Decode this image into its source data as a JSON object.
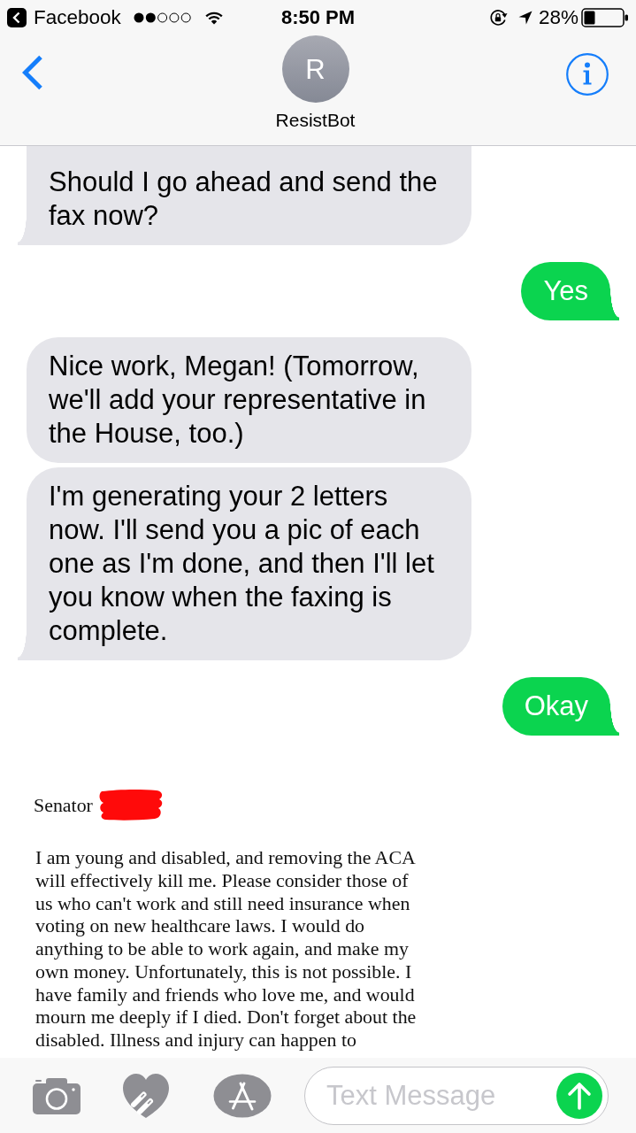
{
  "status_bar": {
    "back_app": "Facebook",
    "time": "8:50 PM",
    "battery": "28%"
  },
  "header": {
    "avatar_initial": "R",
    "contact_name": "ResistBot"
  },
  "messages": [
    {
      "kind": "text",
      "outgoing": false,
      "tail": true,
      "text": "Should I go ahead and send the fax now?"
    },
    {
      "kind": "text",
      "outgoing": true,
      "tail": true,
      "text": "Yes"
    },
    {
      "kind": "text",
      "outgoing": false,
      "tail": false,
      "text": "Nice work, Megan! (Tomorrow, we'll add your representative in the House, too.)"
    },
    {
      "kind": "text",
      "outgoing": false,
      "tail": true,
      "text": "I'm generating your 2 letters now. I'll send you a pic of each one as I'm done, and then I'll let you know when the faxing is complete."
    },
    {
      "kind": "text",
      "outgoing": true,
      "tail": true,
      "text": "Okay"
    },
    {
      "kind": "letter_image",
      "outgoing": false,
      "salutation": "Senator",
      "body": "I am young and disabled, and removing the ACA will effectively kill me. Please consider those of us who can't work and still need insurance when voting on new healthcare laws. I would do anything to be able to work again, and make my own money. Unfortunately, this is not possible. I have family and friends who love me, and would mourn me deeply if I died. Don't forget about the disabled. Illness and injury can happen to"
    }
  ],
  "composer": {
    "placeholder": "Text Message"
  }
}
